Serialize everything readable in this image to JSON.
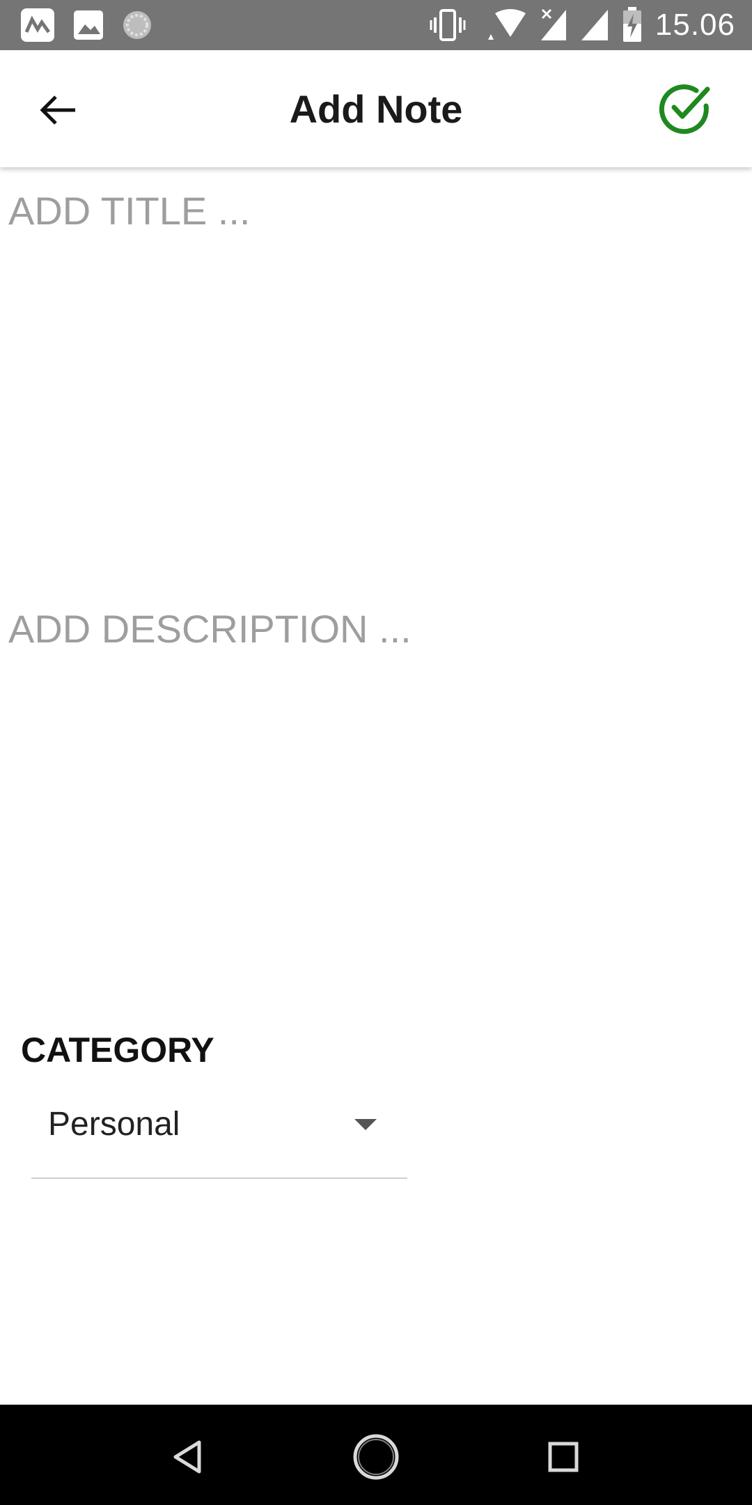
{
  "status_bar": {
    "time": "15.06",
    "left_icons": [
      "app-notification-icon",
      "image-notification-icon",
      "sync-icon"
    ],
    "right_icons": [
      "vibrate-icon",
      "wifi-icon",
      "signal-no-data-icon",
      "signal-icon",
      "battery-charging-icon"
    ]
  },
  "toolbar": {
    "title": "Add Note",
    "back_icon": "arrow-left-icon",
    "save_icon": "check-circle-icon",
    "save_color": "#1e8a1e"
  },
  "form": {
    "title_placeholder": "ADD TITLE ...",
    "description_placeholder": "ADD DESCRIPTION ...",
    "category_label": "CATEGORY",
    "category_selected": "Personal"
  },
  "nav_bar": {
    "icons": [
      "nav-back-icon",
      "nav-home-icon",
      "nav-recents-icon"
    ]
  }
}
